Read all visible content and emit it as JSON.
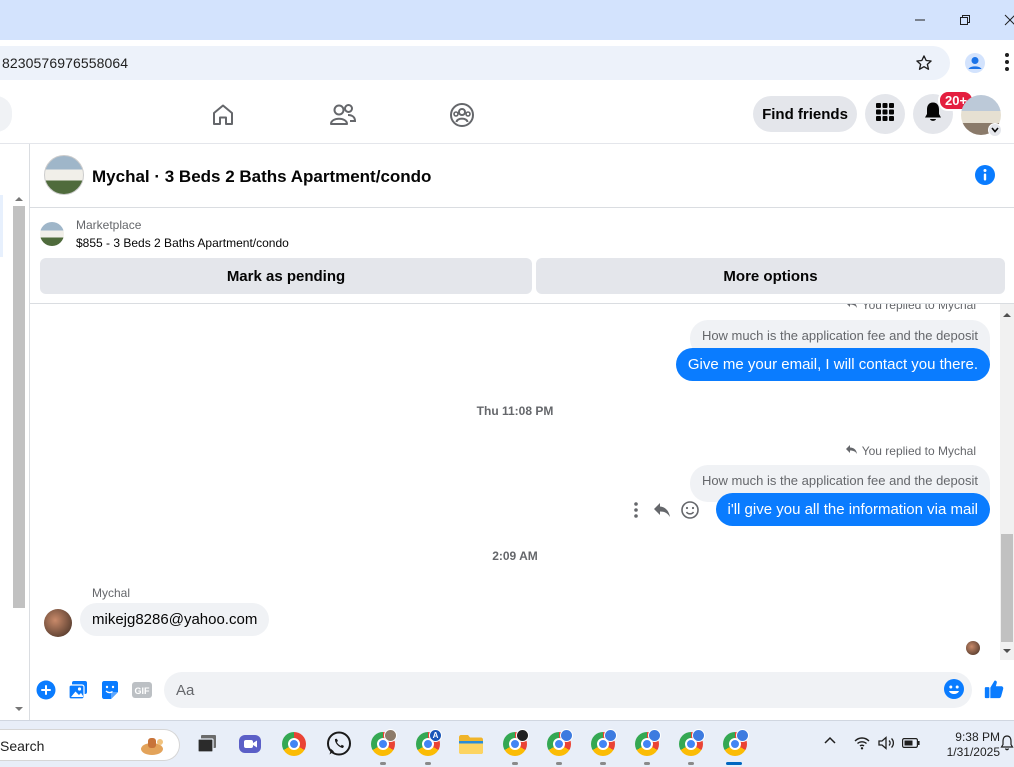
{
  "browser": {
    "url": "8230576976558064"
  },
  "fb_nav": {
    "find_friends_label": "Find friends",
    "notification_count": "20+"
  },
  "chat": {
    "title": "Mychal · 3 Beds 2 Baths Apartment/condo"
  },
  "marketplace": {
    "label": "Marketplace",
    "listing": "$855 - 3 Beds 2 Baths Apartment/condo",
    "mark_pending_label": "Mark as pending",
    "more_options_label": "More options"
  },
  "messages": {
    "replied_1": "You replied to Mychal",
    "quote_1": "How much is the application fee and the deposit",
    "outgoing_1": "Give me your email, I will contact you there.",
    "time_1": "Thu 11:08 PM",
    "replied_2": "You replied to Mychal",
    "quote_2": "How much is the application fee and the deposit",
    "outgoing_2": "i'll give you all the information via mail",
    "time_2": "2:09 AM",
    "sender_name": "Mychal",
    "incoming_1": "mikejg8286@yahoo.com"
  },
  "composer": {
    "placeholder": "Aa"
  },
  "taskbar": {
    "search_label": "Search",
    "time": "9:38 PM",
    "date": "1/31/2025"
  },
  "colors": {
    "brand_blue": "#0a7cff",
    "badge_red": "#e41e3f",
    "titlebar": "#d3e3fd"
  }
}
